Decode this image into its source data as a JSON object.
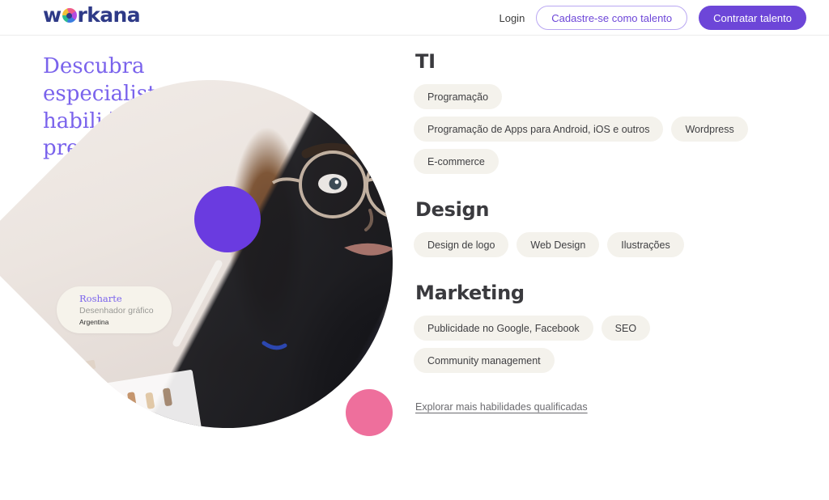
{
  "header": {
    "logo": {
      "pre": "w",
      "mark": "workana-logo-mark",
      "post": "rkana",
      "full": "workana"
    },
    "login_label": "Login",
    "signup_label": "Cadastre-se como talento",
    "hire_label": "Contratar talento",
    "colors": {
      "brand_purple": "#6d46d8",
      "logo_navy": "#2e3a87",
      "outline_border": "#b9a7f2"
    }
  },
  "hero": {
    "headline": "Descubra especialistas com as habilidades que você precisa",
    "headline_color": "#7a63ec",
    "profile_card": {
      "name": "Rosharte",
      "role": "Desenhador gráfico",
      "country": "Argentina"
    },
    "decor": {
      "purple_circle": "#6a3be0",
      "yellow_circle": "#e6c356",
      "pink_circle": "#ee6f9c"
    },
    "photo_alt": "freelancer-illustrator-photo"
  },
  "skills": {
    "sections": [
      {
        "title": "TI",
        "rows": [
          [
            "Programação"
          ],
          [
            "Programação de Apps para Android, iOS e outros",
            "Wordpress"
          ],
          [
            "E-commerce"
          ]
        ]
      },
      {
        "title": "Design",
        "rows": [
          [
            "Design de logo",
            "Web Design",
            "Ilustrações"
          ]
        ]
      },
      {
        "title": "Marketing",
        "rows": [
          [
            "Publicidade no Google, Facebook",
            "SEO"
          ],
          [
            "Community management"
          ]
        ]
      }
    ],
    "explore_link": "Explorar mais habilidades qualificadas",
    "pill_bg": "#f4f2ec"
  }
}
